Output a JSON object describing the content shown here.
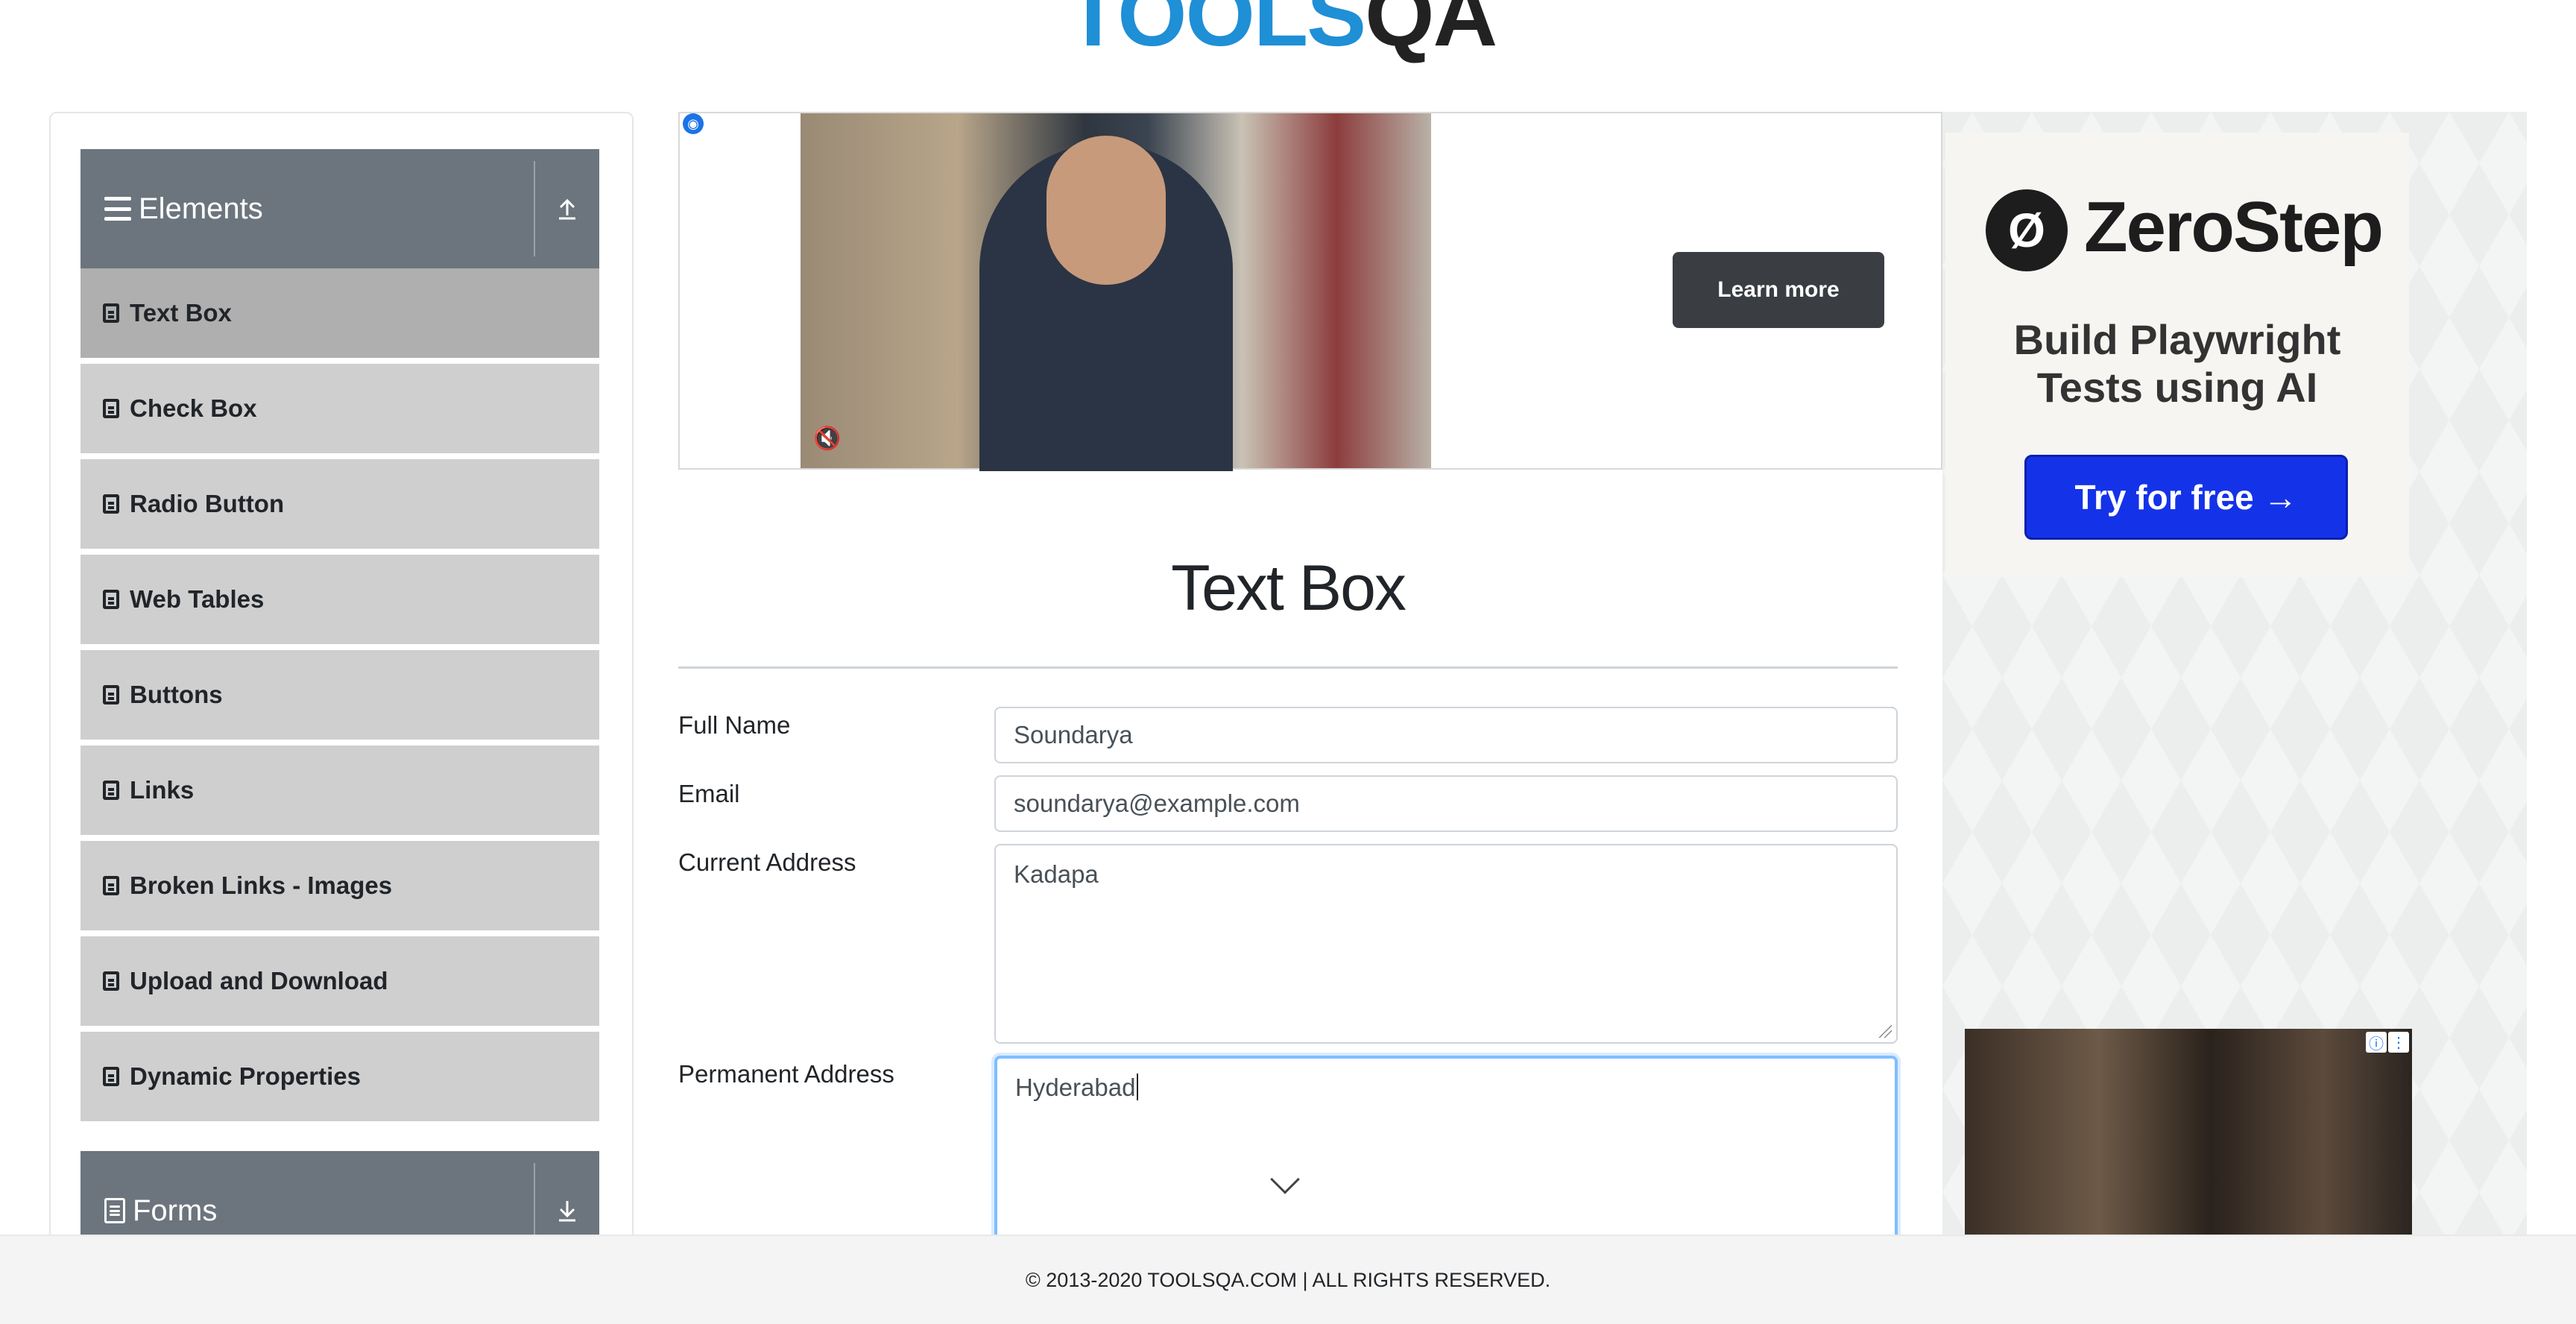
{
  "brand": {
    "logo_tools": "TOOLS",
    "logo_qa": "QA"
  },
  "sidebar": {
    "elements_group": {
      "title": "Elements"
    },
    "items": [
      {
        "label": "Text Box",
        "active": true
      },
      {
        "label": "Check Box"
      },
      {
        "label": "Radio Button"
      },
      {
        "label": "Web Tables"
      },
      {
        "label": "Buttons"
      },
      {
        "label": "Links"
      },
      {
        "label": "Broken Links - Images"
      },
      {
        "label": "Upload and Download"
      },
      {
        "label": "Dynamic Properties"
      }
    ],
    "forms_group": {
      "title": "Forms"
    }
  },
  "ad_banner": {
    "cta_label": "Learn more"
  },
  "main": {
    "title": "Text Box",
    "fields": {
      "full_name": {
        "label": "Full Name",
        "value": "Soundarya"
      },
      "email": {
        "label": "Email",
        "value": "soundarya@example.com"
      },
      "current_address": {
        "label": "Current Address",
        "value": "Kadapa"
      },
      "permanent_address": {
        "label": "Permanent Address",
        "value": "Hyderabad"
      }
    }
  },
  "right_ad": {
    "brand_name": "ZeroStep",
    "tagline_line1": "Build Playwright",
    "tagline_line2": "Tests using AI",
    "cta_label": "Try for free →"
  },
  "footer": {
    "text": "© 2013-2020 TOOLSQA.COM | ALL RIGHTS RESERVED."
  },
  "colors": {
    "sidebar_header": "#6c757d",
    "menu_item": "#cfcfcf",
    "menu_item_active": "#afafaf",
    "focus_border": "#80bdff",
    "zerostep_cta": "#1433e8"
  }
}
